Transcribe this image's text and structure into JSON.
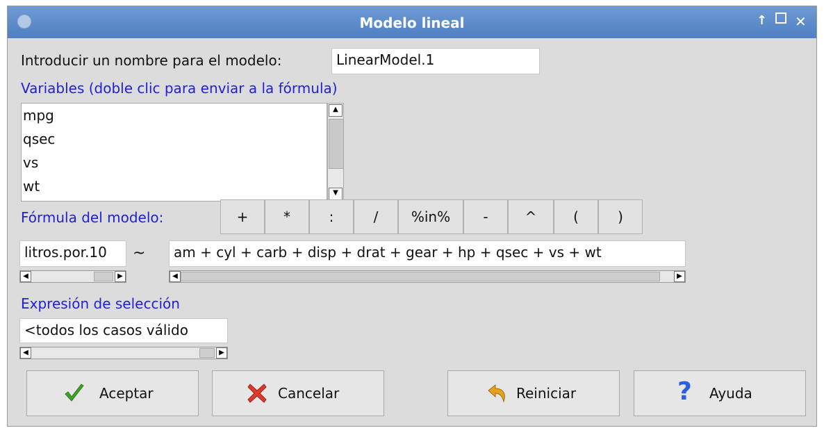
{
  "window": {
    "title": "Modelo lineal",
    "controls": {
      "up": "↑",
      "maximize": "",
      "close": "✕"
    }
  },
  "model_name": {
    "label": "Introducir un nombre para el modelo:",
    "value": "LinearModel.1"
  },
  "variables": {
    "label": "Variables (doble clic para enviar a la fórmula)",
    "items": [
      "mpg",
      "qsec",
      "vs",
      "wt"
    ]
  },
  "formula": {
    "label": "Fórmula del modelo:",
    "operators": [
      "+",
      "*",
      ":",
      "/",
      "%in%",
      "-",
      "^",
      "(",
      ")"
    ],
    "lhs": "litros.por.10",
    "tilde": "~",
    "rhs": "am + cyl + carb + disp + drat + gear + hp + qsec + vs + wt"
  },
  "selection": {
    "label": "Expresión de selección",
    "value": "<todos los casos válido"
  },
  "buttons": {
    "ok": "Aceptar",
    "cancel": "Cancelar",
    "reset": "Reiniciar",
    "help": "Ayuda"
  },
  "icons": {
    "ok": "check-icon",
    "cancel": "x-icon",
    "reset": "undo-arrow-icon",
    "help": "question-icon"
  },
  "colors": {
    "titlebar": "#5b88c9",
    "blue_label": "#1f1fd8",
    "check_green": "#3ea32a",
    "cancel_red": "#d83a2e",
    "reset_orange": "#e6a21a",
    "help_blue": "#2a5fe0"
  }
}
